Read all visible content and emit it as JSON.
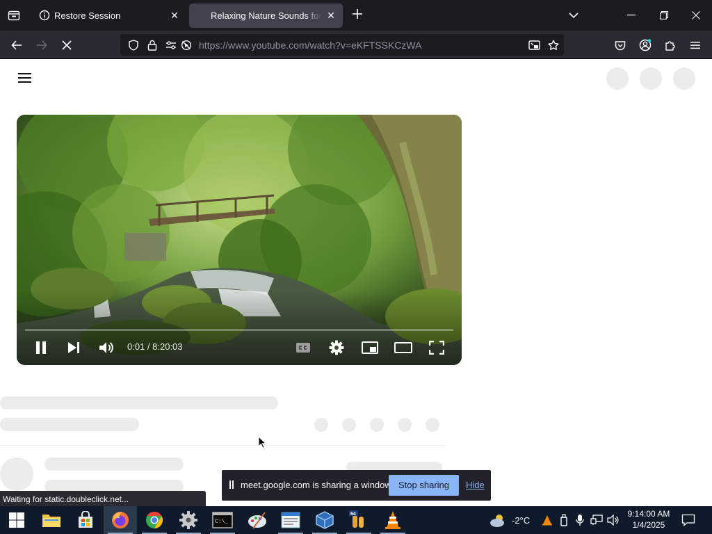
{
  "browser": {
    "tabs": [
      {
        "title": "Restore Session",
        "active": false
      },
      {
        "title": "Relaxing Nature Sounds for Sleep",
        "active": true
      }
    ],
    "url": "https://www.youtube.com/watch?v=eKFTSSKCzWA",
    "status": "Waiting for static.doubleclick.net..."
  },
  "player": {
    "time": "0:01 / 8:20:03",
    "progress": 3e-05,
    "state": "playing"
  },
  "sharing_bar": {
    "message": "meet.google.com is sharing a window.",
    "stop_label": "Stop sharing",
    "hide_label": "Hide"
  },
  "taskbar": {
    "apps": [
      "start-icon",
      "file-explorer-icon",
      "store-icon",
      "firefox-icon",
      "chrome-icon",
      "settings-gear-icon",
      "terminal-icon",
      "paint-icon",
      "notepad-icon",
      "virtualbox-icon",
      "app-64-icon",
      "vlc-icon"
    ],
    "weather": "-2°C",
    "time": "9:14:00 AM",
    "date": "1/4/2025"
  },
  "colors": {
    "tabstrip": "#1c1b22",
    "toolbar": "#2b2a33",
    "share_button": "#8ab4f8",
    "taskbar": "#0f1a2a"
  }
}
